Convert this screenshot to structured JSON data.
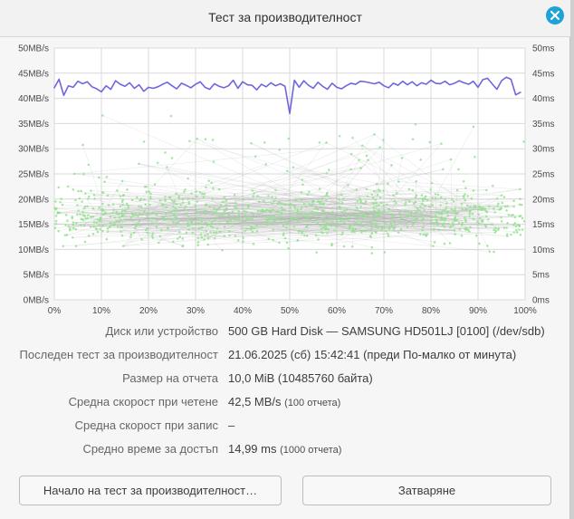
{
  "window": {
    "title": "Тест за производителност"
  },
  "chart_data": {
    "type": "scatter",
    "x_ticks": [
      "0%",
      "10%",
      "20%",
      "30%",
      "40%",
      "50%",
      "60%",
      "70%",
      "80%",
      "90%",
      "100%"
    ],
    "y_left_ticks": [
      "0MB/s",
      "5MB/s",
      "10MB/s",
      "15MB/s",
      "20MB/s",
      "25MB/s",
      "30MB/s",
      "35MB/s",
      "40MB/s",
      "45MB/s",
      "50MB/s"
    ],
    "y_right_ticks": [
      "0ms",
      "5ms",
      "10ms",
      "15ms",
      "20ms",
      "25ms",
      "30ms",
      "35ms",
      "40ms",
      "45ms",
      "50ms"
    ],
    "x_range": [
      0,
      100
    ],
    "y_left_range": [
      0,
      50
    ],
    "y_right_range": [
      0,
      50
    ],
    "grid": true,
    "series": [
      {
        "color": "#6f66df",
        "kind": "line",
        "x": [
          0,
          1,
          2,
          3,
          4,
          5,
          6,
          7,
          8,
          9,
          10,
          11,
          12,
          13,
          14,
          15,
          16,
          17,
          18,
          19,
          20,
          21,
          22,
          23,
          24,
          25,
          26,
          27,
          28,
          29,
          30,
          31,
          32,
          33,
          34,
          35,
          36,
          37,
          38,
          39,
          40,
          41,
          42,
          43,
          44,
          45,
          46,
          47,
          48,
          49,
          50,
          51,
          52,
          53,
          54,
          55,
          56,
          57,
          58,
          59,
          60,
          61,
          62,
          63,
          64,
          65,
          66,
          67,
          68,
          69,
          70,
          71,
          72,
          73,
          74,
          75,
          76,
          77,
          78,
          79,
          80,
          81,
          82,
          83,
          84,
          85,
          86,
          87,
          88,
          89,
          90,
          91,
          92,
          93,
          94,
          95,
          96,
          97,
          98,
          99
        ],
        "values": [
          42.1,
          43.8,
          40.6,
          42.5,
          42.2,
          43.4,
          42.9,
          43.3,
          42.3,
          41.9,
          41.3,
          42.5,
          41.8,
          43.5,
          42.8,
          42.4,
          43.1,
          42.0,
          42.7,
          41.4,
          42.2,
          42.0,
          42.3,
          42.8,
          43.2,
          42.5,
          41.9,
          43.0,
          42.6,
          42.1,
          42.8,
          43.3,
          42.2,
          41.8,
          42.9,
          42.4,
          42.1,
          42.5,
          43.6,
          42.0,
          43.3,
          42.7,
          42.6,
          41.7,
          42.8,
          42.3,
          43.1,
          42.5,
          42.9,
          42.4,
          37.0,
          43.6,
          42.2,
          43.5,
          42.6,
          42.0,
          43.2,
          42.4,
          41.8,
          43.0,
          42.2,
          41.9,
          42.5,
          43.0,
          42.8,
          43.4,
          43.3,
          43.1,
          42.9,
          43.2,
          42.5,
          42.1,
          43.0,
          42.6,
          43.4,
          42.7,
          43.3,
          42.5,
          43.1,
          42.8,
          43.6,
          43.0,
          42.9,
          43.4,
          42.7,
          43.0,
          43.5,
          43.1,
          42.8,
          43.4,
          42.2,
          43.7,
          44.0,
          42.9,
          41.8,
          43.5,
          44.2,
          43.8,
          40.7,
          41.2
        ]
      },
      {
        "color": "#91e38d",
        "kind": "scatter",
        "label": "access_time"
      }
    ]
  },
  "details": {
    "disk": {
      "label": "Диск или устройство",
      "value": "500 GB Hard Disk — SAMSUNG HD501LJ [0100] (/dev/sdb)"
    },
    "last_test": {
      "label": "Последен тест за производителност",
      "value": "21.06.2025 (сб) 15:42:41 (преди По-малко от минута)"
    },
    "sample_size": {
      "label": "Размер на отчета",
      "value": "10,0 MiB (10485760 байта)"
    },
    "read_speed": {
      "label": "Средна скорост при четене",
      "value": "42,5 MB/s",
      "note": "(100 отчета)"
    },
    "write_speed": {
      "label": "Средна скорост при запис",
      "value": "–"
    },
    "access_time": {
      "label": "Средно време за достъп",
      "value": "14,99 ms",
      "note": "(1000 отчета)"
    }
  },
  "buttons": {
    "start": "Начало на тест за производителност…",
    "close": "Затваряне"
  },
  "colors": {
    "accent": "#1ea2d8",
    "read_line": "#6f66df",
    "access_points": "#91e38d"
  }
}
